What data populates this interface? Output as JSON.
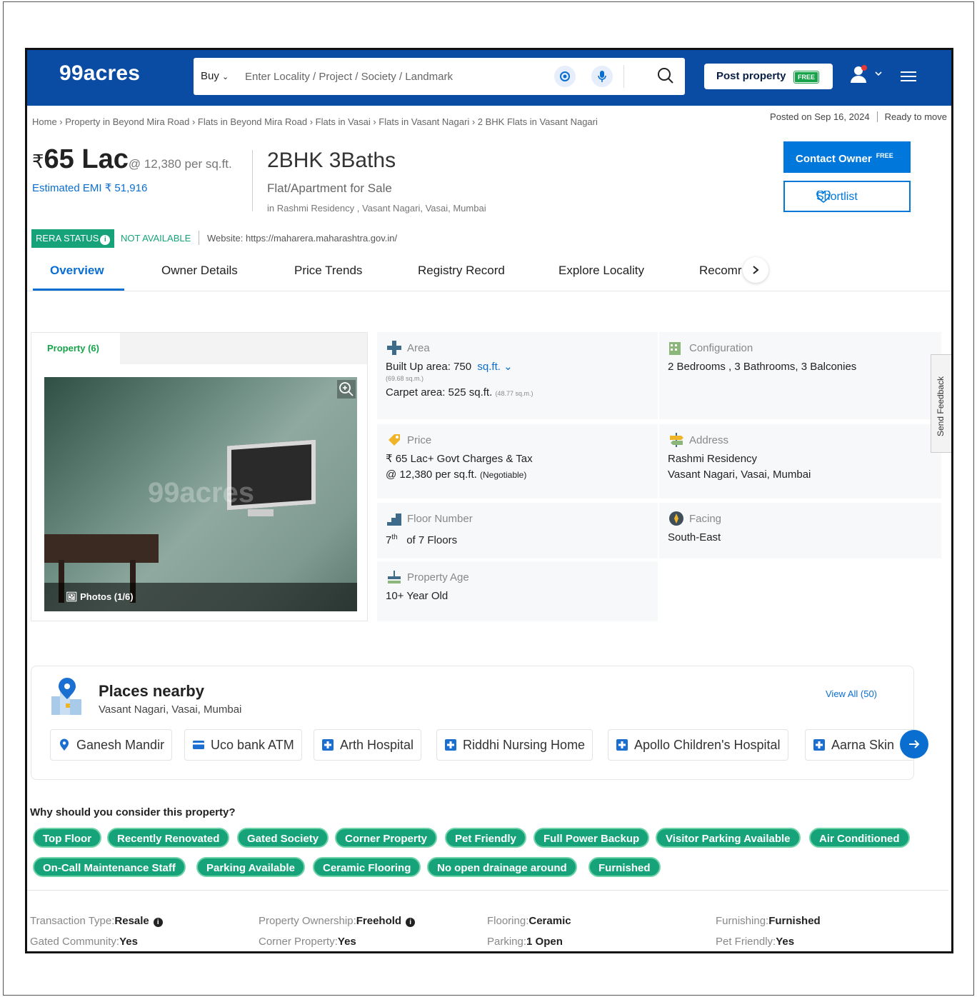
{
  "header": {
    "logo": "99acres",
    "buy_label": "Buy",
    "search_placeholder": "Enter Locality / Project / Society / Landmark",
    "post_property_label": "Post property",
    "post_property_badge": "FREE",
    "brand_color": "#0a4ba3"
  },
  "breadcrumb": "Home › Property in Beyond Mira Road › Flats in Beyond Mira Road › Flats in Vasai › Flats in Vasant Nagari › 2 BHK Flats in Vasant Nagari",
  "posted": {
    "date": "Posted on Sep 16, 2024",
    "status": "Ready to move"
  },
  "price": {
    "currency": "₹",
    "value": "65 Lac",
    "per_sqft": "@ 12,380 per sq.ft.",
    "emi": "Estimated EMI ₹ 51,916"
  },
  "listing": {
    "title": "2BHK 3Baths",
    "subtitle": "Flat/Apartment for Sale",
    "location": "in Rashmi Residency , Vasant Nagari, Vasai, Mumbai"
  },
  "actions": {
    "contact_label": "Contact Owner",
    "contact_badge": "FREE",
    "shortlist_label": "Shortlist"
  },
  "rera": {
    "label": "RERA STATUS",
    "status": "NOT AVAILABLE",
    "website": "Website: https://maharera.maharashtra.gov.in/"
  },
  "tabs": [
    "Overview",
    "Owner Details",
    "Price Trends",
    "Registry Record",
    "Explore Locality",
    "Recomr"
  ],
  "property_card": {
    "tab_label": "Property (6)",
    "photos_label": "Photos (1/6)",
    "watermark": "99acres"
  },
  "details": {
    "area": {
      "label": "Area",
      "built_up": "Built Up area: 750",
      "unit": "sq.ft.",
      "built_up_sqm": "(69.68 sq.m.)",
      "carpet": "Carpet area: 525 sq.ft.",
      "carpet_sqm": "(48.77 sq.m.)"
    },
    "configuration": {
      "label": "Configuration",
      "value": "2 Bedrooms , 3 Bathrooms, 3 Balconies"
    },
    "price": {
      "label": "Price",
      "line1": "₹ 65 Lac+ Govt Charges & Tax",
      "line2": "@ 12,380 per sq.ft.",
      "negotiable": "(Negotiable)"
    },
    "address": {
      "label": "Address",
      "line1": "Rashmi Residency",
      "line2": "Vasant Nagari, Vasai, Mumbai"
    },
    "floor": {
      "label": "Floor Number",
      "floor": "7",
      "suffix": "th",
      "total": "of 7 Floors"
    },
    "facing": {
      "label": "Facing",
      "value": "South-East"
    },
    "age": {
      "label": "Property Age",
      "value": "10+ Year Old"
    }
  },
  "feedback_label": "Send Feedback",
  "places": {
    "title": "Places nearby",
    "subtitle": "Vasant Nagari, Vasai, Mumbai",
    "view_all": "View All (50)",
    "items": [
      "Ganesh Mandir",
      "Uco bank ATM",
      "Arth Hospital",
      "Riddhi Nursing Home",
      "Apollo Children's Hospital",
      "Aarna Skin"
    ]
  },
  "why": {
    "title": "Why should you consider this property?",
    "tags": [
      "Top Floor",
      "Recently Renovated",
      "Gated Society",
      "Corner Property",
      "Pet Friendly",
      "Full Power Backup",
      "Visitor Parking Available",
      "Air Conditioned",
      "On-Call Maintenance Staff",
      "Parking Available",
      "Ceramic Flooring",
      "No open drainage around",
      "Furnished"
    ]
  },
  "facts": [
    {
      "label": "Transaction Type",
      "value": "Resale",
      "info": true
    },
    {
      "label": "Property Ownership",
      "value": "Freehold",
      "info": true
    },
    {
      "label": "Flooring",
      "value": "Ceramic",
      "info": false
    },
    {
      "label": "Furnishing",
      "value": "Furnished",
      "info": false
    },
    {
      "label": "Gated Community",
      "value": "Yes",
      "info": false
    },
    {
      "label": "Corner Property",
      "value": "Yes",
      "info": false
    },
    {
      "label": "Parking",
      "value": "1 Open",
      "info": false
    },
    {
      "label": "Pet Friendly",
      "value": "Yes",
      "info": false
    }
  ]
}
